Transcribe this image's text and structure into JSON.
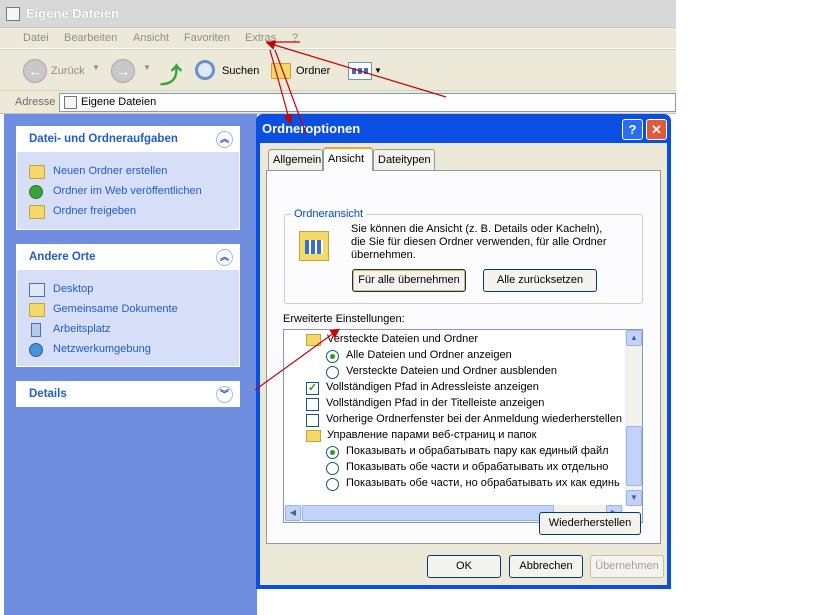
{
  "window": {
    "title": "Eigene Dateien"
  },
  "menu": [
    "Datei",
    "Bearbeiten",
    "Ansicht",
    "Favoriten",
    "Extras",
    "?"
  ],
  "toolbar": {
    "back": "Zurück",
    "search": "Suchen",
    "folders": "Ordner"
  },
  "address": {
    "label": "Adresse",
    "value": "Eigene Dateien"
  },
  "panels": {
    "tasks": {
      "title": "Datei- und Ordneraufgaben",
      "items": [
        "Neuen Ordner erstellen",
        "Ordner im Web veröffentlichen",
        "Ordner freigeben"
      ]
    },
    "places": {
      "title": "Andere Orte",
      "items": [
        "Desktop",
        "Gemeinsame Dokumente",
        "Arbeitsplatz",
        "Netzwerkumgebung"
      ]
    },
    "details": {
      "title": "Details"
    }
  },
  "dialog": {
    "title": "Ordneroptionen",
    "help": "?",
    "close": "✕",
    "tabs": [
      "Allgemein",
      "Ansicht",
      "Dateitypen"
    ],
    "active_tab": "Ansicht",
    "group_title": "Ordneransicht",
    "group_text": [
      "Sie können die Ansicht (z. B. Details oder Kacheln),",
      "die Sie für diesen Ordner verwenden, für alle Ordner",
      "übernehmen."
    ],
    "apply_all": "Für alle übernehmen",
    "reset_all": "Alle zurücksetzen",
    "advanced_label": "Erweiterte Einstellungen:",
    "settings": [
      {
        "type": "folder",
        "text": "Versteckte Dateien und Ordner"
      },
      {
        "type": "radio",
        "checked": true,
        "text": "Alle Dateien und Ordner anzeigen"
      },
      {
        "type": "radio",
        "checked": false,
        "text": "Versteckte Dateien und Ordner ausblenden"
      },
      {
        "type": "check",
        "checked": true,
        "text": "Vollständigen Pfad in Adressleiste anzeigen"
      },
      {
        "type": "check",
        "checked": false,
        "text": "Vollständigen Pfad in der Titelleiste anzeigen"
      },
      {
        "type": "check",
        "checked": false,
        "text": "Vorherige Ordnerfenster bei der Anmeldung wiederherstellen"
      },
      {
        "type": "folder",
        "text": "Управление парами веб-страниц и папок"
      },
      {
        "type": "radio",
        "checked": true,
        "text": "Показывать и обрабатывать пару как единый файл"
      },
      {
        "type": "radio",
        "checked": false,
        "text": "Показывать обе части и обрабатывать их отдельно"
      },
      {
        "type": "radio",
        "checked": false,
        "text": "Показывать обе части, но обрабатывать их как единь"
      }
    ],
    "restore": "Wiederherstellen",
    "ok": "OK",
    "cancel": "Abbrechen",
    "apply": "Übernehmen"
  },
  "colors": {
    "annotation": "#cc0000",
    "title_blue": "#0a4ee2",
    "link": "#215dc6"
  }
}
